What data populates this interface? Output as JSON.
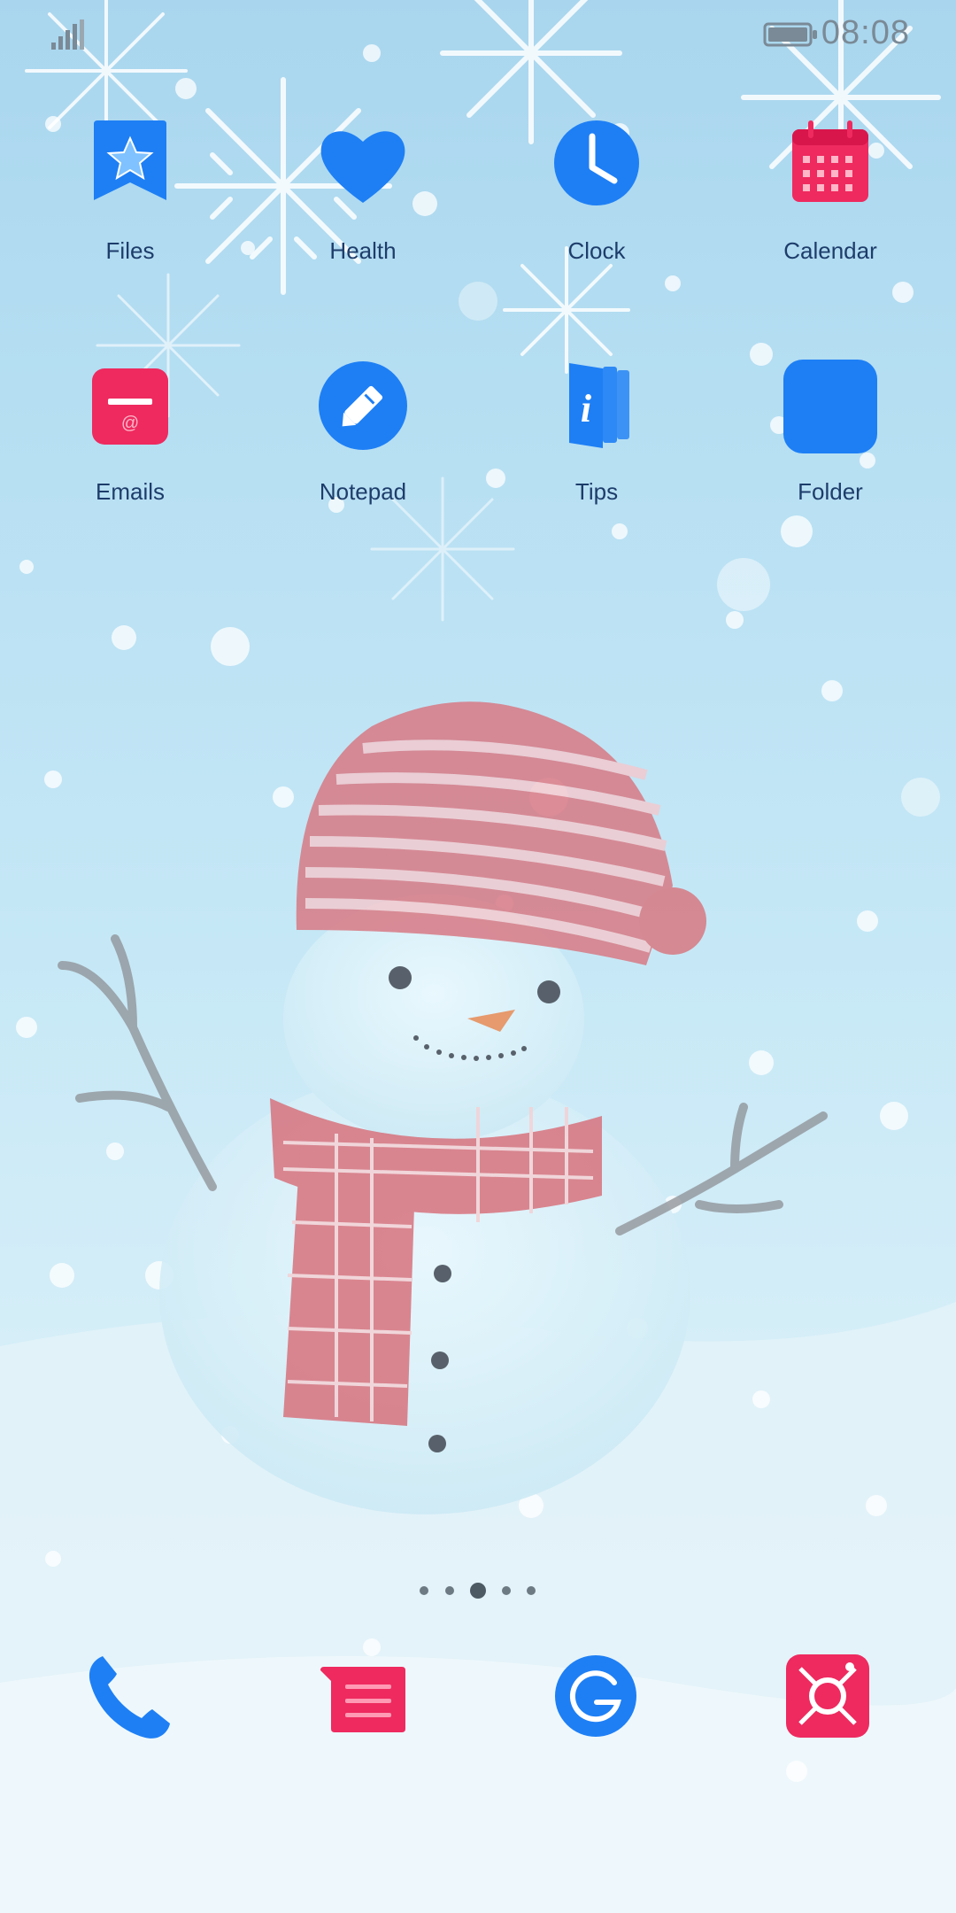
{
  "status_bar": {
    "time": "08:08",
    "signal_icon": "signal-icon",
    "battery_icon": "battery-icon"
  },
  "apps_row1": [
    {
      "label": "Files",
      "icon": "files-icon"
    },
    {
      "label": "Health",
      "icon": "heart-icon"
    },
    {
      "label": "Clock",
      "icon": "clock-icon"
    },
    {
      "label": "Calendar",
      "icon": "calendar-icon"
    }
  ],
  "apps_row2": [
    {
      "label": "Emails",
      "icon": "email-icon"
    },
    {
      "label": "Notepad",
      "icon": "notepad-icon"
    },
    {
      "label": "Tips",
      "icon": "tips-icon"
    },
    {
      "label": "Folder",
      "icon": "folder-icon"
    }
  ],
  "page_indicator": {
    "pages": 5,
    "current": 3
  },
  "dock": [
    {
      "icon": "phone-icon"
    },
    {
      "icon": "messages-icon"
    },
    {
      "icon": "browser-icon"
    },
    {
      "icon": "camera-icon"
    }
  ],
  "colors": {
    "blue": "#1e7ff5",
    "pink": "#ee2a5f",
    "label": "#1d3d6b"
  }
}
